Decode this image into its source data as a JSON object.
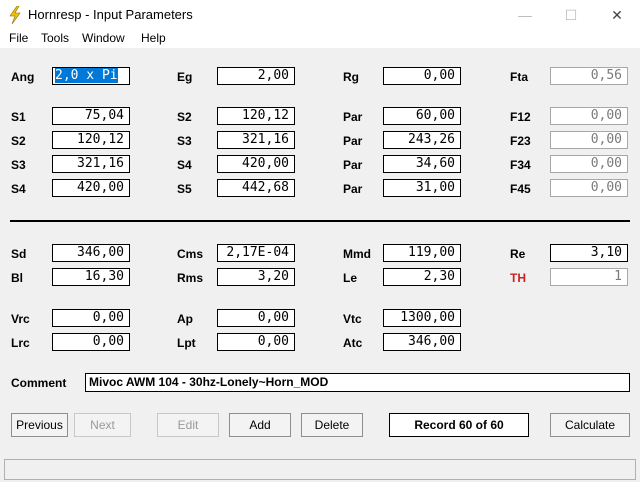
{
  "window": {
    "title": "Hornresp - Input Parameters",
    "minimize": "—",
    "maximize": "☐",
    "close": "✕"
  },
  "menu": [
    "File",
    "Tools",
    "Window",
    "Help"
  ],
  "params": {
    "ang": {
      "label": "Ang",
      "value": "2,0 x Pi"
    },
    "eg": {
      "label": "Eg",
      "value": "2,00"
    },
    "rg": {
      "label": "Rg",
      "value": "0,00"
    },
    "fta": {
      "label": "Fta",
      "value": "0,56"
    },
    "s1": {
      "label": "S1",
      "value": "75,04"
    },
    "s2a": {
      "label": "S2",
      "value": "120,12"
    },
    "par1": {
      "label": "Par",
      "value": "60,00"
    },
    "f12": {
      "label": "F12",
      "value": "0,00"
    },
    "s2b": {
      "label": "S2",
      "value": "120,12"
    },
    "s3a": {
      "label": "S3",
      "value": "321,16"
    },
    "par2": {
      "label": "Par",
      "value": "243,26"
    },
    "f23": {
      "label": "F23",
      "value": "0,00"
    },
    "s3b": {
      "label": "S3",
      "value": "321,16"
    },
    "s4a": {
      "label": "S4",
      "value": "420,00"
    },
    "par3": {
      "label": "Par",
      "value": "34,60"
    },
    "f34": {
      "label": "F34",
      "value": "0,00"
    },
    "s4b": {
      "label": "S4",
      "value": "420,00"
    },
    "s5": {
      "label": "S5",
      "value": "442,68"
    },
    "par4": {
      "label": "Par",
      "value": "31,00"
    },
    "f45": {
      "label": "F45",
      "value": "0,00"
    },
    "sd": {
      "label": "Sd",
      "value": "346,00"
    },
    "cms": {
      "label": "Cms",
      "value": "2,17E-04"
    },
    "mmd": {
      "label": "Mmd",
      "value": "119,00"
    },
    "re": {
      "label": "Re",
      "value": "3,10"
    },
    "bl": {
      "label": "Bl",
      "value": "16,30"
    },
    "rms": {
      "label": "Rms",
      "value": "3,20"
    },
    "le": {
      "label": "Le",
      "value": "2,30"
    },
    "th": {
      "label": "TH",
      "value": "1"
    },
    "vrc": {
      "label": "Vrc",
      "value": "0,00"
    },
    "ap": {
      "label": "Ap",
      "value": "0,00"
    },
    "vtc": {
      "label": "Vtc",
      "value": "1300,00"
    },
    "lrc": {
      "label": "Lrc",
      "value": "0,00"
    },
    "lpt": {
      "label": "Lpt",
      "value": "0,00"
    },
    "atc": {
      "label": "Atc",
      "value": "346,00"
    }
  },
  "comment": {
    "label": "Comment",
    "value": "Mivoc AWM 104 - 30hz-Lonely~Horn_MOD"
  },
  "buttons": {
    "previous": "Previous",
    "next": "Next",
    "edit": "Edit",
    "add": "Add",
    "delete": "Delete",
    "calculate": "Calculate"
  },
  "record": "Record 60 of 60",
  "colors": {
    "selection": "#0078d7",
    "th_label": "#cc2222"
  }
}
